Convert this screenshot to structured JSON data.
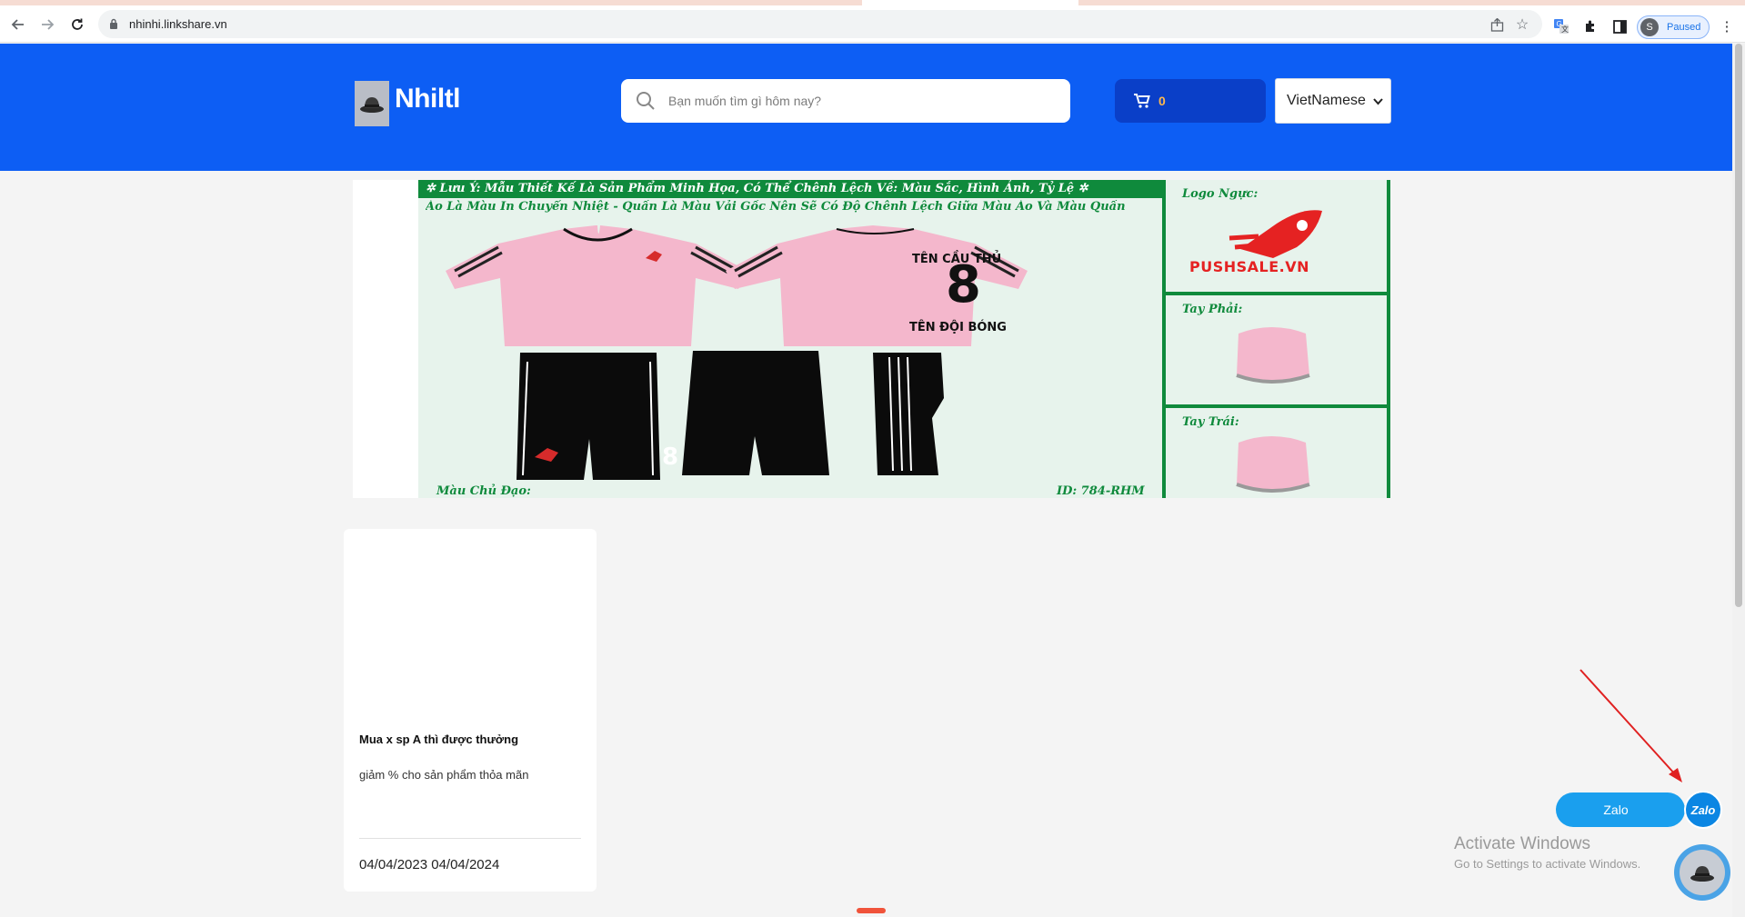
{
  "browser": {
    "url": "nhinhi.linkshare.vn",
    "profile_initial": "S",
    "profile_status": "Paused",
    "icons": [
      "back-icon",
      "forward-icon",
      "reload-icon",
      "lock-icon",
      "share-icon",
      "star-icon",
      "translate-icon",
      "extensions-icon",
      "sidepanel-icon",
      "kebab-menu-icon"
    ]
  },
  "header": {
    "brand": "Nhiltl",
    "search_placeholder": "Bạn muốn tìm gì hôm nay?",
    "cart_count": "0",
    "language": "VietNamese",
    "colors": {
      "header_bg": "#0d5ef4",
      "cart_bg": "#0a3fc8",
      "cart_count": "#ffb84d"
    }
  },
  "banner": {
    "note_line1": "Lưu Ý: Mẫu Thiết Kế Là Sản Phẩm Minh Họa, Có Thể Chênh Lệch Về: Màu Sắc, Hình Ảnh, Tỷ Lệ",
    "note_line2": "Áo Là Màu In Chuyển Nhiệt - Quần Là Màu Vải Gốc Nên Sẽ Có Độ Chênh Lệch Giữa Màu Áo Và Màu Quần",
    "player_name": "TÊN CẦU THỦ",
    "number": "8",
    "team_name": "TÊN ĐỘI BÓNG",
    "logo_label": "Logo Ngực:",
    "brand_logo": "PUSHSALE.VN",
    "right_sleeve_label": "Tay Phải:",
    "left_sleeve_label": "Tay Trái:",
    "main_color_label": "Màu Chủ Đạo:",
    "design_id": "ID: 784-RHM"
  },
  "card": {
    "title": "Mua x sp A thì được thưởng",
    "description": "giảm % cho sản phẩm thỏa mãn",
    "dates": "04/04/2023 04/04/2024"
  },
  "widgets": {
    "zalo_label": "Zalo",
    "zalo_logo": "Zalo"
  },
  "os_overlay": {
    "title": "Activate Windows",
    "subtitle": "Go to Settings to activate Windows."
  }
}
